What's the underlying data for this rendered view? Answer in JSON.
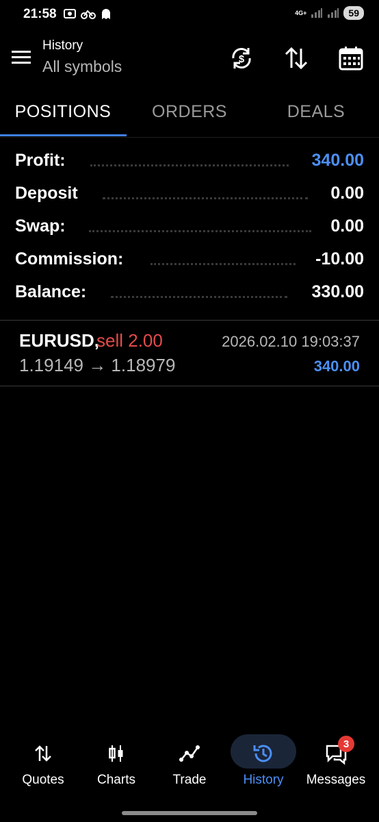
{
  "status_bar": {
    "time": "21:58",
    "network": "4G+",
    "battery": "59"
  },
  "header": {
    "title": "History",
    "subtitle": "All symbols"
  },
  "tabs": [
    {
      "label": "POSITIONS",
      "active": true
    },
    {
      "label": "ORDERS",
      "active": false
    },
    {
      "label": "DEALS",
      "active": false
    }
  ],
  "summary": {
    "profit": {
      "label": "Profit:",
      "value": "340.00"
    },
    "deposit": {
      "label": "Deposit",
      "value": "0.00"
    },
    "swap": {
      "label": "Swap:",
      "value": "0.00"
    },
    "commission": {
      "label": "Commission:",
      "value": "-10.00"
    },
    "balance": {
      "label": "Balance:",
      "value": "330.00"
    }
  },
  "position": {
    "symbol": "EURUSD,",
    "side": "sell 2.00",
    "prices": "1.19149 → 1.18979",
    "datetime": "2026.02.10 19:03:37",
    "profit": "340.00"
  },
  "bottom_nav": {
    "items": [
      {
        "label": "Quotes",
        "icon": "quotes-icon"
      },
      {
        "label": "Charts",
        "icon": "charts-icon"
      },
      {
        "label": "Trade",
        "icon": "trade-icon"
      },
      {
        "label": "History",
        "icon": "history-icon",
        "active": true
      },
      {
        "label": "Messages",
        "icon": "messages-icon"
      }
    ],
    "messages_badge": "3"
  },
  "colors": {
    "accent": "#4c8ff5",
    "sell": "#e44b4b",
    "background": "#000000"
  }
}
